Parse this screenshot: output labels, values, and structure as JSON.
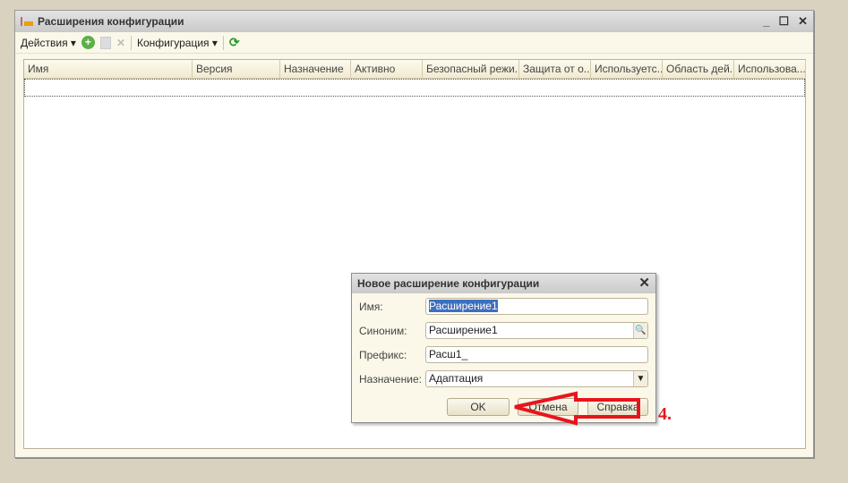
{
  "window": {
    "title": "Расширения конфигурации",
    "controls": [
      "_",
      "☐",
      "✕"
    ]
  },
  "toolbar": {
    "actions": "Действия",
    "config": "Конфигурация"
  },
  "table": {
    "columns": [
      "Имя",
      "Версия",
      "Назначение",
      "Активно",
      "Безопасный режи...",
      "Защита от о...",
      "Используетс...",
      "Область дей...",
      "Использова..."
    ]
  },
  "dialog": {
    "title": "Новое расширение конфигурации",
    "fields": [
      {
        "label": "Имя:",
        "value": "Расширение1"
      },
      {
        "label": "Синоним:",
        "value": "Расширение1"
      },
      {
        "label": "Префикс:",
        "value": "Расш1_"
      },
      {
        "label": "Назначение:",
        "value": "Адаптация"
      }
    ],
    "buttons": {
      "ok": "OK",
      "cancel": "Отмена",
      "help": "Справка"
    }
  },
  "annotation": {
    "step": "4.",
    "color": "#e8141c"
  }
}
